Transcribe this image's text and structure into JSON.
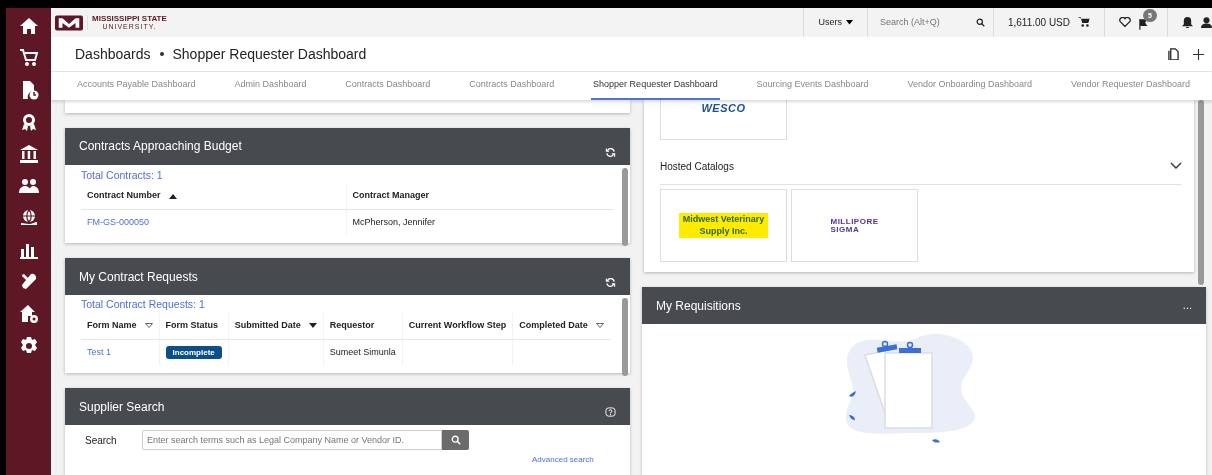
{
  "logo": {
    "name": "MISSISSIPPI STATE",
    "sub": "UNIVERSITY."
  },
  "sidebar": {
    "items": [
      {
        "kind": "home"
      },
      {
        "kind": "cart"
      },
      {
        "kind": "document"
      },
      {
        "kind": "award"
      },
      {
        "kind": "bank"
      },
      {
        "kind": "people"
      },
      {
        "kind": "globe"
      },
      {
        "kind": "chart"
      },
      {
        "kind": "tools"
      },
      {
        "kind": "house"
      },
      {
        "kind": "gear"
      }
    ]
  },
  "topbar": {
    "users_menu": "Users",
    "search": {
      "placeholder": "Search (Alt+Q)"
    },
    "cart_total": "1,611.00 USD",
    "flag_badge": "5"
  },
  "breadcrumb": [
    "Dashboards",
    "Shopper Requester Dashboard"
  ],
  "tabs": [
    {
      "label": "Accounts Payable Dashboard",
      "selected": false
    },
    {
      "label": "Admin Dashboard",
      "selected": false
    },
    {
      "label": "Contracts Dashboard",
      "selected": false
    },
    {
      "label": "Contracts Dashboard",
      "selected": false
    },
    {
      "label": "Shopper Requester Dashboard",
      "selected": true
    },
    {
      "label": "Sourcing Events Dashboard",
      "selected": false
    },
    {
      "label": "Vendor Onboarding Dashboard",
      "selected": false
    },
    {
      "label": "Vendor Requester Dashboard",
      "selected": false
    }
  ],
  "contracts_budget": {
    "title": "Contracts Approaching Budget",
    "total": "Total Contracts: 1",
    "columns": [
      {
        "label": "Contract Number",
        "kind": "ascending"
      },
      {
        "label": "Contract Manager",
        "kind": "plain"
      }
    ],
    "rows": [
      [
        "FM-GS-000050",
        "McPherson, Jennifer"
      ]
    ]
  },
  "contract_requests": {
    "title": "My Contract Requests",
    "total": "Total Contract Requests: 1",
    "columns": [
      {
        "label": "Form Name",
        "kind": "sortable"
      },
      {
        "label": "Form Status",
        "kind": "plain"
      },
      {
        "label": "Submitted Date",
        "kind": "descending"
      },
      {
        "label": "Requestor",
        "kind": "plain"
      },
      {
        "label": "Current Workflow Step",
        "kind": "plain"
      },
      {
        "label": "Completed Date",
        "kind": "sortable"
      }
    ],
    "rows": [
      {
        "form_name": "Test 1",
        "status": "Incomplete",
        "requestor": "Sumeet Simunla"
      }
    ]
  },
  "supplier_search": {
    "title": "Supplier Search",
    "label": "Search",
    "placeholder": "Enter search terms such as Legal Company Name or Vendor ID.",
    "advanced": "Advanced search"
  },
  "catalogs": {
    "punchout_logo": "WESCO",
    "hosted_title": "Hosted Catalogs",
    "expanded": true,
    "hosted": [
      {
        "kind": "highlight",
        "lines": [
          "Midwest Veterinary",
          "Supply Inc."
        ]
      },
      {
        "kind": "logo",
        "lines": [
          "MILLIPORE",
          "SIGMA"
        ]
      }
    ]
  },
  "requisitions": {
    "title": "My Requisitions",
    "menu": "..."
  }
}
